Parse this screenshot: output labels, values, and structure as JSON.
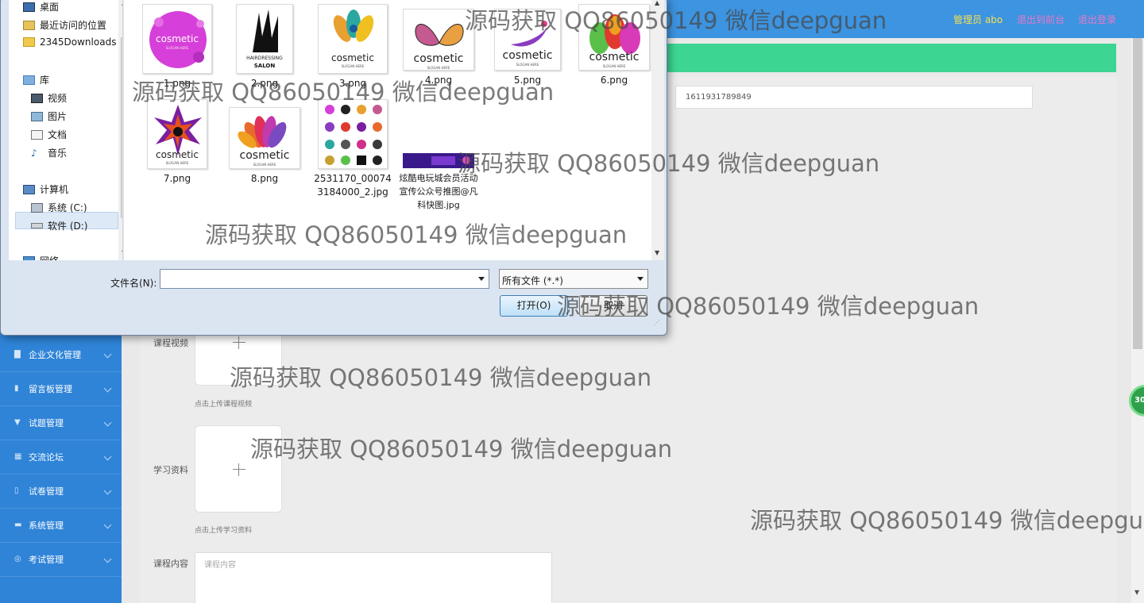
{
  "header": {
    "admin_label": "管理员 abo",
    "to_front_label": "退出到前台",
    "logout_label": "退出登录"
  },
  "sidebar": {
    "items": [
      {
        "label": "企业文化管理",
        "icon": "trash-icon"
      },
      {
        "label": "留言板管理",
        "icon": "bar-chart-icon"
      },
      {
        "label": "试题管理",
        "icon": "pin-icon"
      },
      {
        "label": "交流论坛",
        "icon": "film-icon"
      },
      {
        "label": "试卷管理",
        "icon": "mic-icon"
      },
      {
        "label": "系统管理",
        "icon": "monitor-icon"
      },
      {
        "label": "考试管理",
        "icon": "gear-icon"
      }
    ]
  },
  "form": {
    "id_value": "1611931789849",
    "video_label": "课程视频",
    "video_hint": "点击上传课程视频",
    "material_label": "学习资料",
    "material_hint": "点击上传学习资料",
    "content_label": "课程内容",
    "content_placeholder": "课程内容"
  },
  "float_button": "30",
  "dialog": {
    "nav": {
      "items": [
        {
          "label": "桌面",
          "icon": "desktop-icon"
        },
        {
          "label": "最近访问的位置",
          "icon": "recent-places-icon"
        },
        {
          "label": "2345Downloads",
          "icon": "folder-icon"
        },
        {
          "label": "库",
          "icon": "library-icon"
        },
        {
          "label": "视频",
          "icon": "video-library-icon"
        },
        {
          "label": "图片",
          "icon": "pictures-library-icon"
        },
        {
          "label": "文档",
          "icon": "documents-library-icon"
        },
        {
          "label": "音乐",
          "icon": "music-library-icon"
        },
        {
          "label": "计算机",
          "icon": "computer-icon"
        },
        {
          "label": "系统 (C:)",
          "icon": "system-drive-icon"
        },
        {
          "label": "软件 (D:)",
          "icon": "drive-icon"
        },
        {
          "label": "网络",
          "icon": "network-icon"
        }
      ]
    },
    "files": [
      {
        "name": "1.png",
        "brand": "cosmetic",
        "slogan": "SLOGAN HERE",
        "color": "#d63fd9"
      },
      {
        "name": "2.png",
        "brand": "HAIRDRESSING",
        "slogan": "SALON",
        "color": "#111111"
      },
      {
        "name": "3.png",
        "brand": "cosmetic",
        "slogan": "SLOGAN HERE",
        "color": "#e8a030"
      },
      {
        "name": "4.png",
        "brand": "cosmetic",
        "slogan": "SLOGAN HERE",
        "color": "#c45a90"
      },
      {
        "name": "5.png",
        "brand": "cosmetic",
        "slogan": "SLOGAN HERE",
        "color": "#8a3cc0"
      },
      {
        "name": "6.png",
        "brand": "cosmetic",
        "slogan": "SLOGAN HERE",
        "color": "#e03a30"
      },
      {
        "name": "7.png",
        "brand": "cosmetic",
        "slogan": "SLOGAN HERE",
        "color": "#7a1fa0"
      },
      {
        "name": "8.png",
        "brand": "cosmetic",
        "slogan": "SLOGAN HERE",
        "color": "#e86a2c"
      },
      {
        "name": "2531170_000743184000_2.jpg",
        "brand": "",
        "slogan": "",
        "color": "#c0506a"
      },
      {
        "name": "炫酷电玩城会员活动宣传公众号推图@凡科快图.jpg",
        "brand": "",
        "slogan": "",
        "color": "#3a1a8a"
      }
    ],
    "filename_label": "文件名(N):",
    "filename_value": "",
    "filetype_value": "所有文件 (*.*)",
    "open_label": "打开(O)",
    "cancel_label": "取消"
  },
  "watermark": "源码获取 QQ86050149 微信deepguan",
  "colors": {
    "topbar": "#3d94e0",
    "sidebar": "#2f84d8",
    "green_bar": "#3dd592"
  }
}
